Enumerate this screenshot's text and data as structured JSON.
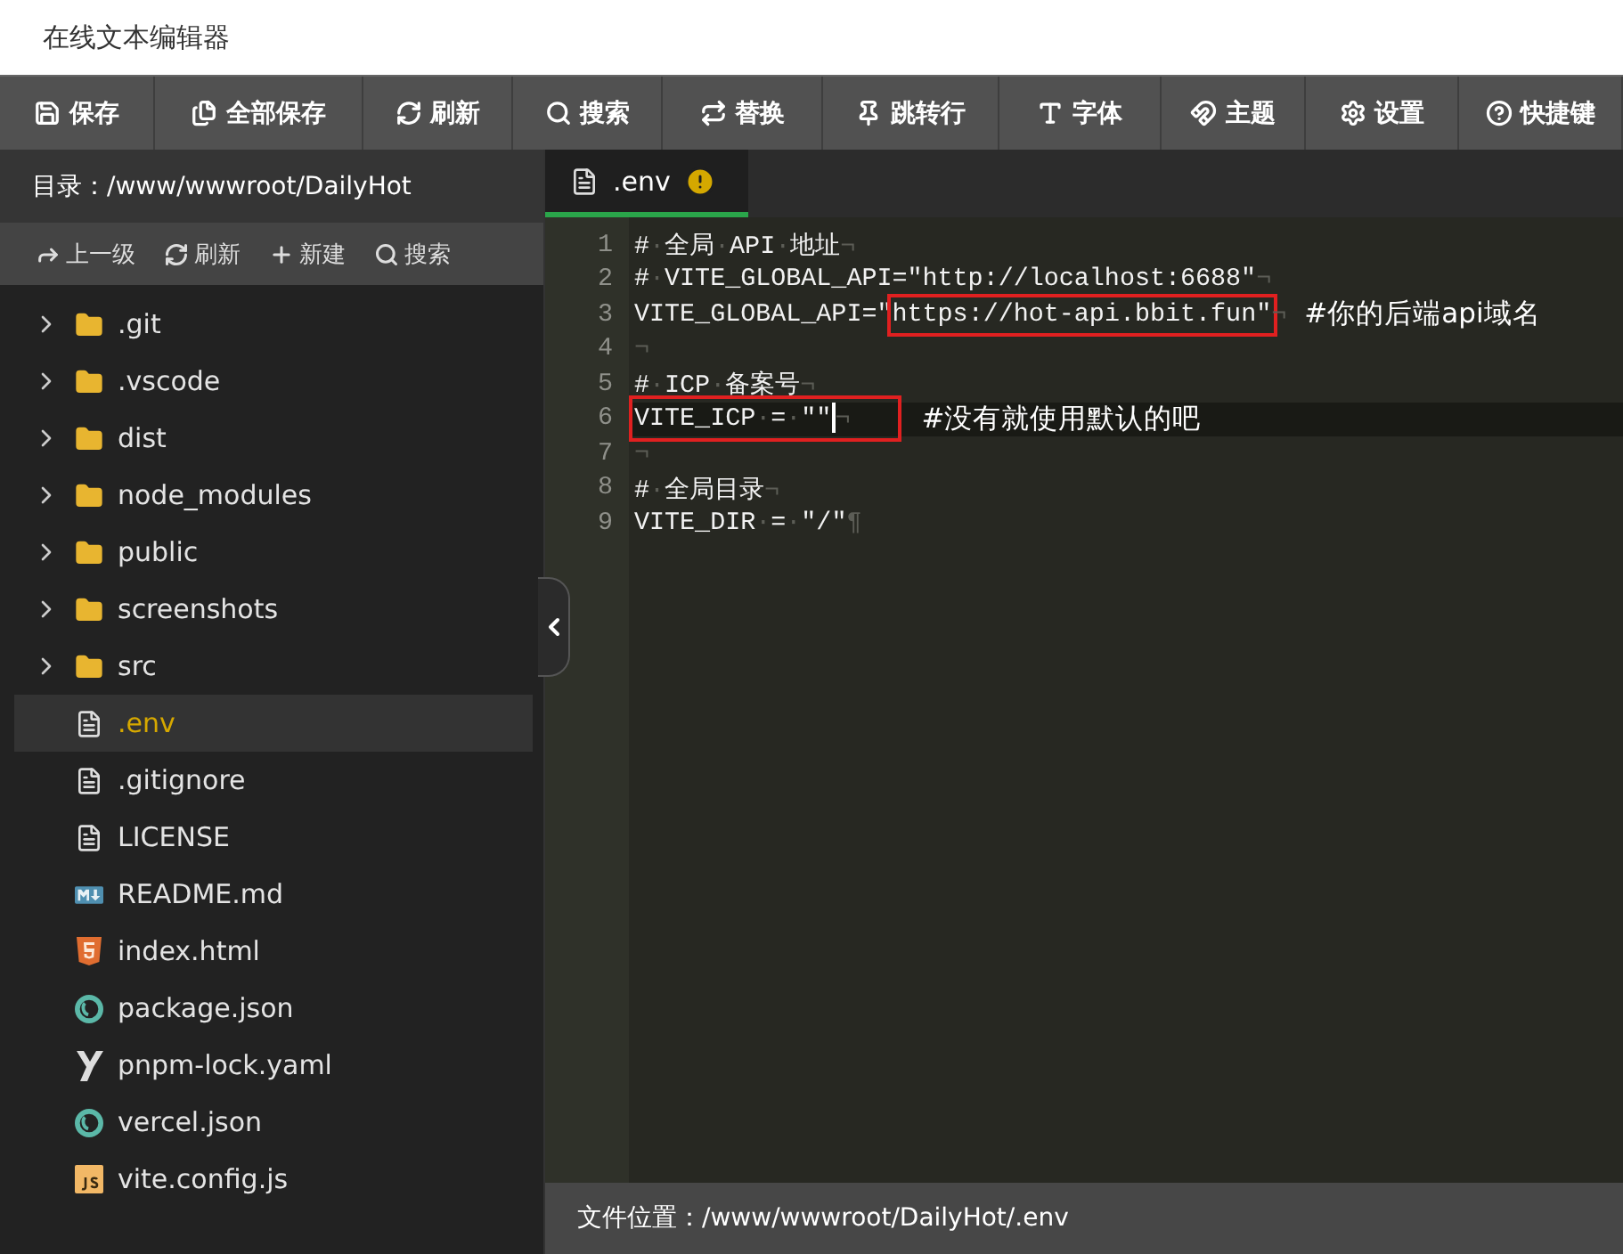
{
  "window": {
    "title": "在线文本编辑器"
  },
  "toolbar": [
    {
      "label": "保存"
    },
    {
      "label": "全部保存"
    },
    {
      "label": "刷新"
    },
    {
      "label": "搜索"
    },
    {
      "label": "替换"
    },
    {
      "label": "跳转行"
    },
    {
      "label": "字体"
    },
    {
      "label": "主题"
    },
    {
      "label": "设置"
    },
    {
      "label": "快捷键"
    }
  ],
  "sidebar": {
    "path": "目录：/www/wwwroot/DailyHot",
    "actions": [
      {
        "label": "上一级"
      },
      {
        "label": "刷新"
      },
      {
        "label": "新建"
      },
      {
        "label": "搜索"
      }
    ],
    "items": [
      {
        "name": ".git",
        "kind": "folder",
        "selected": false
      },
      {
        "name": ".vscode",
        "kind": "folder",
        "selected": false
      },
      {
        "name": "dist",
        "kind": "folder",
        "selected": false
      },
      {
        "name": "node_modules",
        "kind": "folder",
        "selected": false
      },
      {
        "name": "public",
        "kind": "folder",
        "selected": false
      },
      {
        "name": "screenshots",
        "kind": "folder",
        "selected": false
      },
      {
        "name": "src",
        "kind": "folder",
        "selected": false
      },
      {
        "name": ".env",
        "kind": "file",
        "selected": true
      },
      {
        "name": ".gitignore",
        "kind": "file",
        "selected": false
      },
      {
        "name": "LICENSE",
        "kind": "file",
        "selected": false
      },
      {
        "name": "README.md",
        "kind": "markdown",
        "selected": false
      },
      {
        "name": "index.html",
        "kind": "html",
        "selected": false
      },
      {
        "name": "package.json",
        "kind": "json",
        "selected": false
      },
      {
        "name": "pnpm-lock.yaml",
        "kind": "yaml",
        "selected": false
      },
      {
        "name": "vercel.json",
        "kind": "json",
        "selected": false
      },
      {
        "name": "vite.config.js",
        "kind": "js",
        "selected": false
      }
    ]
  },
  "tabs": [
    {
      "label": ".env",
      "selected": true,
      "unsaved": true
    }
  ],
  "editor": {
    "lines": [
      {
        "number": "1",
        "code": "#·全局·API·地址¬",
        "selected": false
      },
      {
        "number": "2",
        "code": "#·VITE_GLOBAL_API=\"http://localhost:6688\"¬",
        "selected": false
      },
      {
        "number": "3",
        "code": "VITE_GLOBAL_API=\"",
        "boxed": "https://hot-api.bbit.fun\"",
        "tail": "¬",
        "note": "#你的后端api域名",
        "selected": false
      },
      {
        "number": "4",
        "code": "¬",
        "selected": false
      },
      {
        "number": "5",
        "code": "#·ICP·备案号¬",
        "selected": false
      },
      {
        "number": "6",
        "boxed": "VITE_ICP·=·\"\"",
        "tail": "¬",
        "note": "#没有就使用默认的吧",
        "selected": true
      },
      {
        "number": "7",
        "code": "¬",
        "selected": false
      },
      {
        "number": "8",
        "code": "#·全局目录¬",
        "selected": false
      },
      {
        "number": "9",
        "code": "VITE_DIR·=·\"/\"¶",
        "selected": false
      }
    ]
  },
  "status_bar": "文件位置：/www/wwwroot/DailyHot/.env"
}
